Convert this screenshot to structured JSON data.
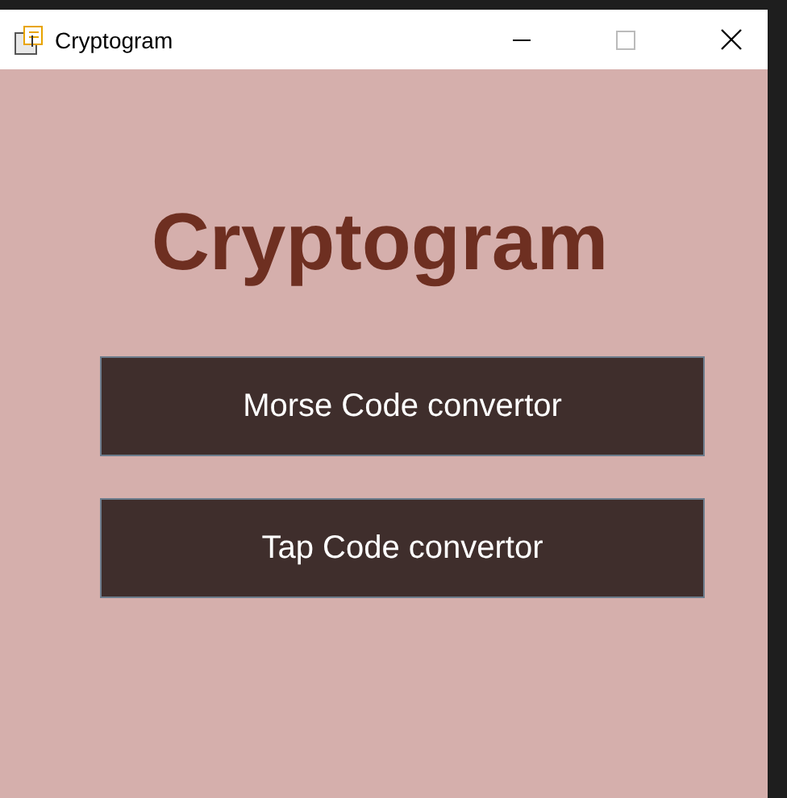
{
  "window": {
    "title": "Cryptogram"
  },
  "heading": "Cryptogram",
  "buttons": [
    "Morse Code convertor",
    "Tap Code convertor"
  ]
}
